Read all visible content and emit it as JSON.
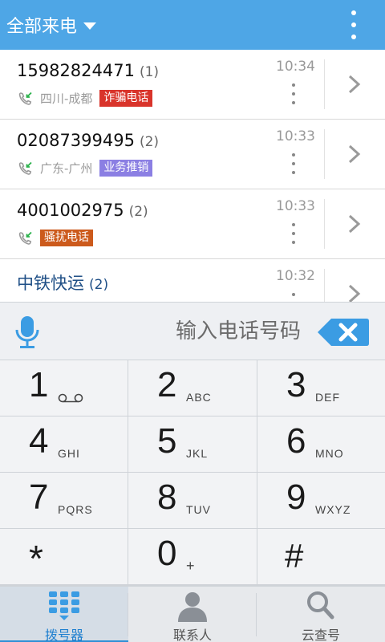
{
  "header": {
    "title": "全部来电",
    "menu_icon": "overflow-menu-icon"
  },
  "calls": [
    {
      "number": "15982824471",
      "count": "(1)",
      "location": "四川-成都",
      "tag": "诈骗电话",
      "tag_color": "#d9342b",
      "time": "10:34"
    },
    {
      "number": "02087399495",
      "count": "(2)",
      "location": "广东-广州",
      "tag": "业务推销",
      "tag_color": "#8b7fe3",
      "time": "10:33"
    },
    {
      "number": "4001002975",
      "count": "(2)",
      "location": "",
      "tag": "骚扰电话",
      "tag_color": "#cc5a1c",
      "time": "10:33"
    },
    {
      "number": "中铁快运",
      "count": "(2)",
      "location": "",
      "tag": "",
      "tag_color": "",
      "time": "10:32"
    }
  ],
  "input": {
    "placeholder": "输入电话号码",
    "value": ""
  },
  "keypad": [
    {
      "digit": "1",
      "letters": ""
    },
    {
      "digit": "2",
      "letters": "ABC"
    },
    {
      "digit": "3",
      "letters": "DEF"
    },
    {
      "digit": "4",
      "letters": "GHI"
    },
    {
      "digit": "5",
      "letters": "JKL"
    },
    {
      "digit": "6",
      "letters": "MNO"
    },
    {
      "digit": "7",
      "letters": "PQRS"
    },
    {
      "digit": "8",
      "letters": "TUV"
    },
    {
      "digit": "9",
      "letters": "WXYZ"
    },
    {
      "digit": "*",
      "letters": ""
    },
    {
      "digit": "0",
      "letters": "+"
    },
    {
      "digit": "#",
      "letters": ""
    }
  ],
  "nav": [
    {
      "label": "拨号器",
      "icon": "dialpad-icon",
      "active": true
    },
    {
      "label": "联系人",
      "icon": "contacts-icon",
      "active": false
    },
    {
      "label": "云查号",
      "icon": "search-icon",
      "active": false
    }
  ],
  "colors": {
    "accent": "#4ea6e6",
    "fraud_tag": "#d9342b",
    "sales_tag": "#8b7fe3",
    "harass_tag": "#cc5a1c",
    "incoming_arrow": "#2bb24c"
  }
}
